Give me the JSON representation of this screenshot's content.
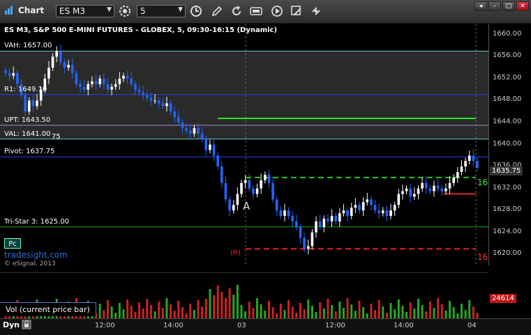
{
  "toolbar": {
    "title": "Chart",
    "symbol": "ES M3",
    "interval": "5"
  },
  "chart": {
    "header": "ES M3, S&P 500 E-MINI FUTURES - GLOBEX, 5, 09:30-16:15 (Dynamic)",
    "watermark": "tradesight.com",
    "copyright": "© eSignal, 2013",
    "pc_label": "Pc",
    "point_a": "A",
    "r_marker": "(R)",
    "levels": [
      {
        "label": "VAH: 1657.00",
        "price": 1657.0,
        "color": "#66cccc"
      },
      {
        "label": "R1: 1649.10",
        "price": 1649.1,
        "color": "#2244ff"
      },
      {
        "label": "UPT: 1643.50",
        "price": 1643.5,
        "color": "#aa88cc"
      },
      {
        "label": "VAL: 1641.00",
        "price": 1641.0,
        "color": "#66cccc"
      },
      {
        "label": "Pivot: 1637.75",
        "price": 1637.75,
        "color": "#2244ff"
      },
      {
        "label": "Tri-Star 3: 1625.00",
        "price": 1625.0,
        "color": "#11aa11"
      }
    ],
    "extra_labels": [
      "75"
    ],
    "short_green_price": 1644.75,
    "green_dashed_price": 1634.0,
    "red_dashed_price": 1621.0,
    "red_short_price": 1631.0,
    "green_right_text": "16",
    "red_right_text": "16",
    "current_price": "1635.75",
    "volume_badge": "24614",
    "volume_label": "Vol (current price bar)",
    "dyn_label": "Dyn"
  },
  "chart_data": {
    "type": "candlestick",
    "ylim": [
      1618,
      1662
    ],
    "yticks": [
      "1660.00",
      "1656.00",
      "1652.00",
      "1648.00",
      "1644.00",
      "1640.00",
      "1636.00",
      "1632.00",
      "1628.00",
      "1624.00",
      "1620.00"
    ],
    "ytick_values": [
      1660,
      1656,
      1652,
      1648,
      1644,
      1640,
      1636,
      1632,
      1628,
      1624,
      1620
    ],
    "xticks": [
      "12:00",
      "14:00",
      "03",
      "12:00",
      "14:00",
      "04"
    ],
    "closes": [
      1653,
      1652.5,
      1653,
      1651,
      1649,
      1646,
      1648,
      1647,
      1648,
      1650,
      1652,
      1654,
      1656,
      1657,
      1655,
      1654,
      1654.5,
      1653,
      1651,
      1650.5,
      1650,
      1651,
      1651.5,
      1651,
      1652,
      1651,
      1650,
      1650.5,
      1651,
      1652,
      1652.5,
      1652,
      1651,
      1650,
      1649.5,
      1649,
      1648.5,
      1648,
      1648,
      1647.5,
      1647,
      1647.5,
      1646,
      1645,
      1644,
      1643,
      1642.5,
      1642,
      1643,
      1642,
      1641,
      1639,
      1640,
      1638,
      1636,
      1633,
      1630,
      1628,
      1629,
      1631,
      1633,
      1633.5,
      1632,
      1631,
      1632,
      1633.5,
      1634.5,
      1633,
      1630,
      1628,
      1627,
      1628,
      1627,
      1626,
      1625,
      1623,
      1621,
      1621.5,
      1624,
      1626,
      1625,
      1626.5,
      1626,
      1627,
      1626,
      1627.5,
      1628,
      1627,
      1628.5,
      1629,
      1628,
      1629.5,
      1630,
      1629,
      1628,
      1627.5,
      1628,
      1627,
      1628,
      1629,
      1631,
      1631.5,
      1632,
      1630.5,
      1631,
      1632,
      1633,
      1632,
      1631.5,
      1632.5,
      1632,
      1631.5,
      1632,
      1633,
      1634,
      1635,
      1636,
      1637,
      1638,
      1637,
      1635.75
    ]
  }
}
